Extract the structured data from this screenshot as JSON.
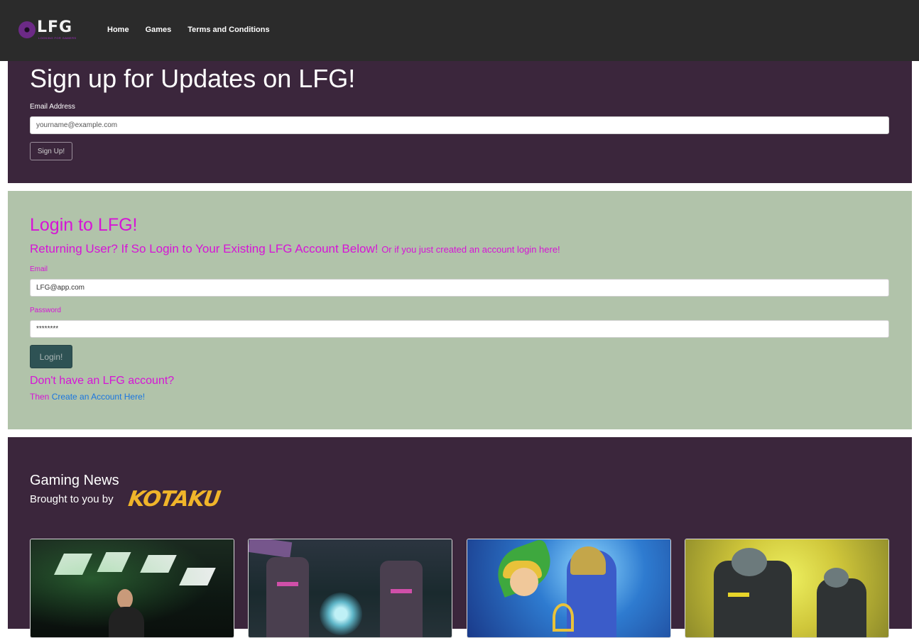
{
  "navbar": {
    "logo": {
      "mark": "LFG",
      "tagline": "LOOKING FOR GAMERS"
    },
    "links": [
      {
        "label": "Home"
      },
      {
        "label": "Games"
      },
      {
        "label": "Terms and Conditions"
      }
    ]
  },
  "signup": {
    "title": "Sign up for Updates on LFG!",
    "email_label": "Email Address",
    "email_placeholder": "yourname@example.com",
    "button_label": "Sign Up!"
  },
  "login": {
    "title": "Login to LFG!",
    "subtitle": "Returning User? If So Login to Your Existing LFG Account Below!",
    "subtitle_small": "Or if you just created an account login here!",
    "email_label": "Email",
    "email_value": "LFG@app.com",
    "password_label": "Password",
    "password_value": "********",
    "button_label": "Login!",
    "no_account_heading": "Don't have an LFG account?",
    "then_text": "Then",
    "create_link_label": "Create an Account Here!"
  },
  "news": {
    "title": "Gaming News",
    "subtitle": "Brought to you by",
    "brand": "KOTAKU",
    "cards": [
      {
        "image": "news-image-1"
      },
      {
        "image": "news-image-2"
      },
      {
        "image": "news-image-3"
      },
      {
        "image": "news-image-4"
      }
    ]
  },
  "colors": {
    "navbar_bg": "#2b2b2b",
    "section_purple": "#3b263c",
    "section_green": "#b1c3aa",
    "accent_magenta": "#d614d6",
    "link_blue": "#1a76e0",
    "login_button": "#2e5254",
    "kotaku_yellow": "#f0b52a"
  }
}
